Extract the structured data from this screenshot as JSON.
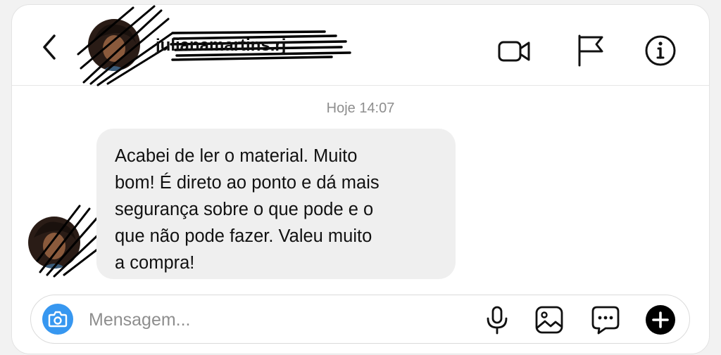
{
  "header": {
    "username": "julianamartins.rj",
    "icons": [
      "chevron-left-icon",
      "video-camera-icon",
      "flag-icon",
      "info-icon"
    ]
  },
  "thread": {
    "timestamp": "Hoje 14:07",
    "message": {
      "lines": [
        "Acabei de ler o material. Muito",
        "bom! É direto ao ponto e dá mais",
        "segurança sobre o que pode e o",
        "que não pode fazer. Valeu muito",
        "a compra!"
      ]
    }
  },
  "composer": {
    "placeholder": "Mensagem...",
    "icons": [
      "camera-icon",
      "microphone-icon",
      "image-icon",
      "sticker-icon",
      "plus-icon"
    ]
  },
  "colors": {
    "accent": "#3797f0",
    "bubble": "#efefef",
    "text": "#111111",
    "muted": "#8e8e8e",
    "border": "#dbdbdb"
  }
}
